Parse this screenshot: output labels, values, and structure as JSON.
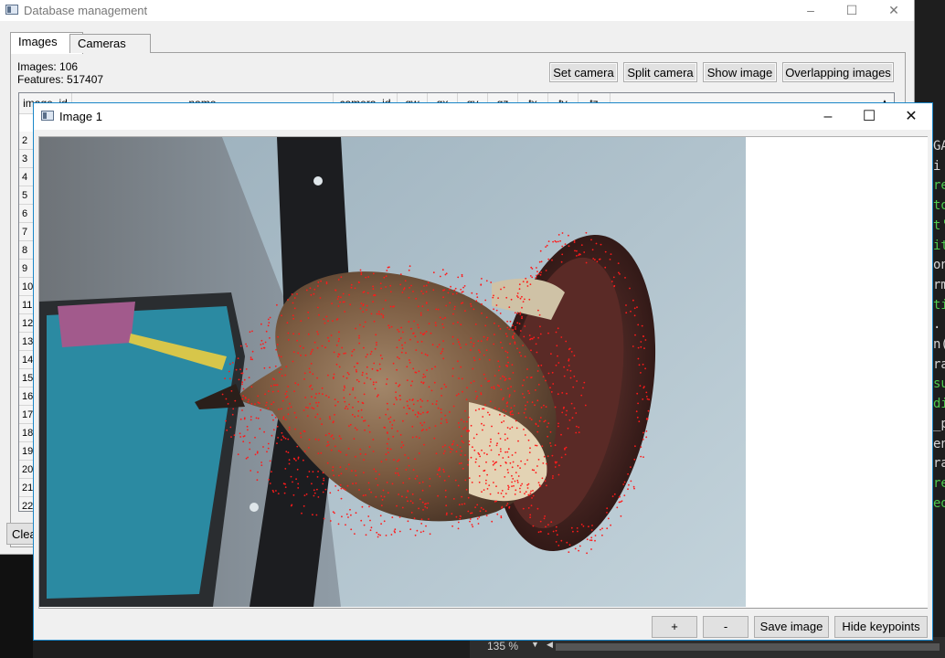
{
  "editor": {
    "lines": [
      {
        "text": "GA",
        "color": "w"
      },
      {
        "text": "",
        "color": "w"
      },
      {
        "text": "i",
        "color": "w"
      },
      {
        "text": "",
        "color": "w"
      },
      {
        "text": "re",
        "color": "g"
      },
      {
        "text": "to",
        "color": "g"
      },
      {
        "text": "t'",
        "color": "g"
      },
      {
        "text": "it",
        "color": "g"
      },
      {
        "text": "on",
        "color": "w"
      },
      {
        "text": "rm",
        "color": "w"
      },
      {
        "text": "ti",
        "color": "g"
      },
      {
        "text": ".",
        "color": "w"
      },
      {
        "text": "n(",
        "color": "w"
      },
      {
        "text": "",
        "color": "w"
      },
      {
        "text": "",
        "color": "w"
      },
      {
        "text": "ra",
        "color": "w"
      },
      {
        "text": "su",
        "color": "g"
      },
      {
        "text": "di",
        "color": "g"
      },
      {
        "text": "_p",
        "color": "w"
      },
      {
        "text": "en",
        "color": "w"
      },
      {
        "text": "ra",
        "color": "w"
      },
      {
        "text": "re",
        "color": "g"
      },
      {
        "text": "ed",
        "color": "g"
      }
    ]
  },
  "editor_status": {
    "zoom": "135 %"
  },
  "db_window": {
    "title": "Database management",
    "tabs": [
      "Images",
      "Cameras"
    ],
    "images_count": "Images: 106",
    "features_count": "Features: 517407",
    "buttons": {
      "set_camera": "Set camera",
      "split_camera": "Split camera",
      "show_image": "Show image",
      "overlapping_images": "Overlapping images"
    },
    "columns": [
      "image_id",
      "name",
      "camera_id",
      "qw",
      "qx",
      "qy",
      "qz",
      "tx",
      "ty",
      "tz"
    ],
    "row_numbers": [
      "2",
      "3",
      "4",
      "5",
      "6",
      "7",
      "8",
      "9",
      "10",
      "11",
      "12",
      "13",
      "14",
      "15",
      "16",
      "17",
      "18",
      "19",
      "20",
      "21",
      "22"
    ],
    "clear_label": "Clea"
  },
  "image_window": {
    "title": "Image 1",
    "buttons": {
      "zoom_in": "+",
      "zoom_out": "-",
      "save_image": "Save image",
      "hide_keypoints": "Hide keypoints"
    }
  },
  "colors": {
    "keypoint": "#ff1a1a",
    "active_border": "#1a86c8",
    "editor_green": "#4ec94e"
  }
}
